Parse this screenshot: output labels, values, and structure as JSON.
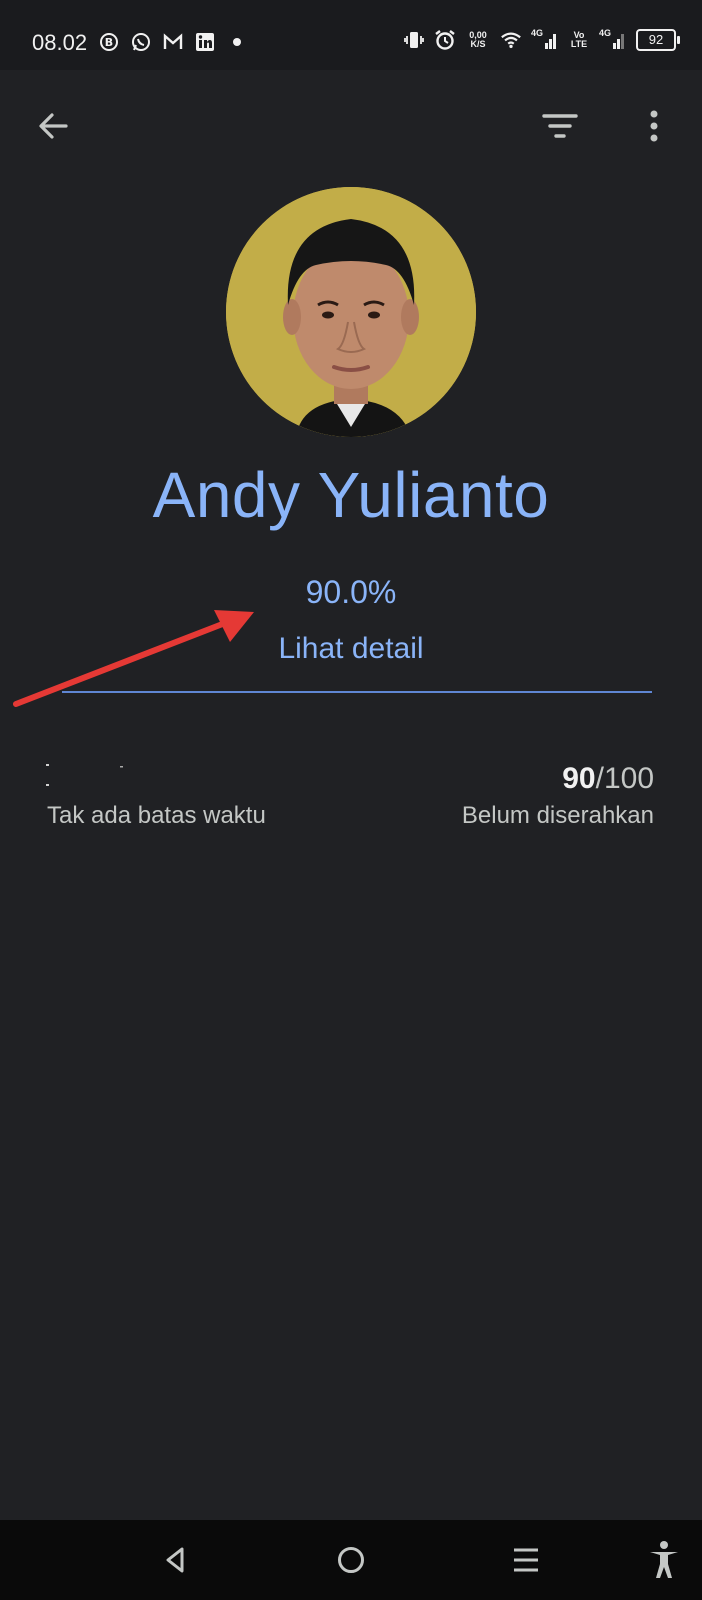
{
  "status_bar": {
    "time": "08.02",
    "left_icons": [
      "bip-icon",
      "whatsapp-icon",
      "gmail-icon",
      "linkedin-icon",
      "notification-dot-icon"
    ],
    "net_speed_top": "0,00",
    "net_speed_bottom": "K/S",
    "sim1_label": "4G",
    "volte_top": "Vo",
    "volte_bottom": "LTE",
    "sim2_label": "4G",
    "battery": "92"
  },
  "app_bar": {
    "back_icon": "arrow-back-icon",
    "filter_icon": "filter-icon",
    "more_icon": "more-vert-icon"
  },
  "student": {
    "name": "Andy Yulianto",
    "overall_grade": "90.0%",
    "view_detail_label": "Lihat detail"
  },
  "assignments": [
    {
      "deadline": "Tak ada batas waktu",
      "score_value": "90",
      "score_total": "/100",
      "status": "Belum diserahkan"
    }
  ],
  "nav_bar": {
    "icons": [
      "nav-back-icon",
      "nav-home-icon",
      "nav-recents-icon",
      "accessibility-icon"
    ]
  },
  "colors": {
    "background": "#202124",
    "accent": "#8ab4f8",
    "divider": "#5f86d3",
    "annotation": "#e53935"
  }
}
